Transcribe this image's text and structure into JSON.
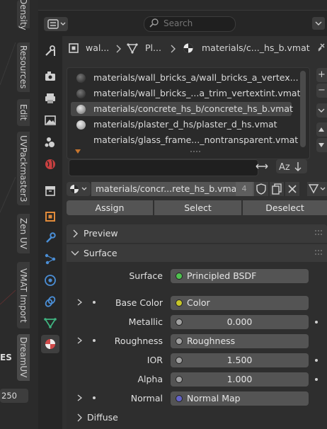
{
  "viewport_tabs": [
    "Density",
    "Resources",
    "Edit",
    "UVPackmaster3",
    "Zen UV",
    "VMAT Import",
    "DreamUV"
  ],
  "viewport_bottom": {
    "tools_label": "ES",
    "frame_value": "250"
  },
  "header": {
    "search_placeholder": "Search"
  },
  "breadcrumb": {
    "object": "wal...",
    "mesh": "Pl...",
    "material": "materials/c..._hs_b.vmat"
  },
  "material_slots": [
    "materials/wall_bricks_a/wall_bricks_a_vertex...",
    "materials/wall_bricks_...a_trim_vertextint.vmat",
    "materials/concrete_hs_b/concrete_hs_b.vmat",
    "materials/plaster_d_hs/plaster_d_hs.vmat",
    "materials/glass_frame..._nontransparent.vmat"
  ],
  "selected_slot": 2,
  "slot_filter_value": "",
  "material": {
    "name": "materials/concr...rete_hs_b.vmat",
    "users": "4"
  },
  "actions": {
    "assign": "Assign",
    "select": "Select",
    "deselect": "Deselect"
  },
  "panels": {
    "preview": "Preview",
    "surface": "Surface",
    "diffuse": "Diffuse"
  },
  "surface": {
    "surface": {
      "label": "Surface",
      "value": "Principled BSDF",
      "color": "#4fc24f"
    },
    "base_color": {
      "label": "Base Color",
      "value": "Color",
      "color": "#c7c729"
    },
    "metallic": {
      "label": "Metallic",
      "value": "0.000"
    },
    "roughness": {
      "label": "Roughness",
      "value": "Roughness"
    },
    "ior": {
      "label": "IOR",
      "value": "1.500"
    },
    "alpha": {
      "label": "Alpha",
      "value": "1.000"
    },
    "normal": {
      "label": "Normal",
      "value": "Normal Map",
      "color": "#6363c7"
    }
  },
  "colors": {
    "accent": "#e07b39",
    "selected_slot": "#474747"
  }
}
